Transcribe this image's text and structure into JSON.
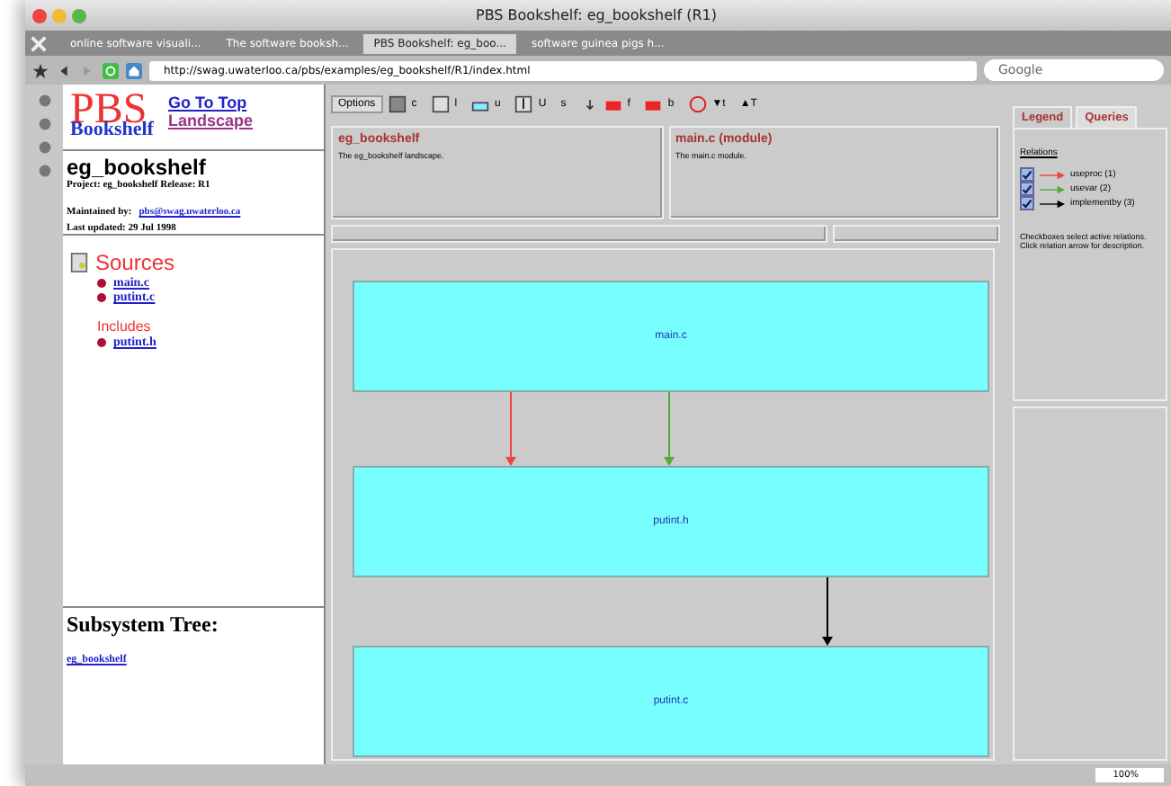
{
  "window": {
    "title": "PBS Bookshelf: eg_bookshelf (R1)"
  },
  "browser_tabs": [
    {
      "label": "online software visuali...",
      "selected": false
    },
    {
      "label": "The software booksh...",
      "selected": false
    },
    {
      "label": "PBS Bookshelf: eg_boo...",
      "selected": true
    },
    {
      "label": "software guinea pigs h...",
      "selected": false
    }
  ],
  "address_bar": {
    "url": "http://swag.uwaterloo.ca/pbs/examples/eg_bookshelf/R1/index.html"
  },
  "search": {
    "placeholder": "Google"
  },
  "page": {
    "logo": {
      "big": "PBS",
      "small": "Bookshelf"
    },
    "nav_links": [
      "Go To Top",
      "Landscape"
    ],
    "heading": "eg_bookshelf",
    "project_line": "Project: eg_bookshelf   Release: R1",
    "maintained_label": "Maintained by:",
    "maintained_email": "pbs@swag.uwaterloo.ca",
    "updated_line": "Last updated: 29 Jul 1998",
    "sources_title": "Sources",
    "sources": [
      "main.c",
      "putint.c"
    ],
    "includes_title": "Includes",
    "includes": [
      "putint.h"
    ],
    "tree_title": "Subsystem Tree:",
    "tree_link": "eg_bookshelf"
  },
  "applet": {
    "options_button": "Options",
    "toolbar": [
      {
        "kind": "box",
        "label": "c"
      },
      {
        "kind": "corner",
        "label": "l"
      },
      {
        "kind": "flat",
        "label": "u"
      },
      {
        "kind": "up",
        "label": "U"
      },
      {
        "kind": "text",
        "label": "s"
      },
      {
        "kind": "down"
      },
      {
        "kind": "red",
        "label": "f"
      },
      {
        "kind": "red",
        "label": "b"
      },
      {
        "kind": "help"
      },
      {
        "kind": "text",
        "label": "▼t"
      },
      {
        "kind": "text",
        "label": "▲T"
      }
    ],
    "info_panels": [
      {
        "title": "eg_bookshelf",
        "text": "The eg_bookshelf landscape."
      },
      {
        "title": "main.c (module)",
        "text": "The main.c module."
      }
    ],
    "nodes": [
      {
        "label": "main.c"
      },
      {
        "label": "putint.h"
      },
      {
        "label": "putint.c"
      }
    ],
    "edges": [
      {
        "color": "#ee4444"
      },
      {
        "color": "#55aa33"
      },
      {
        "color": "#000000"
      }
    ],
    "side_tabs": [
      {
        "label": "Legend",
        "selected": false
      },
      {
        "label": "Queries",
        "selected": true
      }
    ],
    "relations_title": "Relations",
    "relations": [
      {
        "label": "useproc (1)",
        "checked": true,
        "color": "#ee4444"
      },
      {
        "label": "usevar (2)",
        "checked": true,
        "color": "#55aa33"
      },
      {
        "label": "implementby (3)",
        "checked": true,
        "color": "#000000"
      }
    ],
    "note": "Checkboxes select active relations. Click relation arrow for description."
  },
  "status_bar": {
    "zoom": "100%"
  }
}
